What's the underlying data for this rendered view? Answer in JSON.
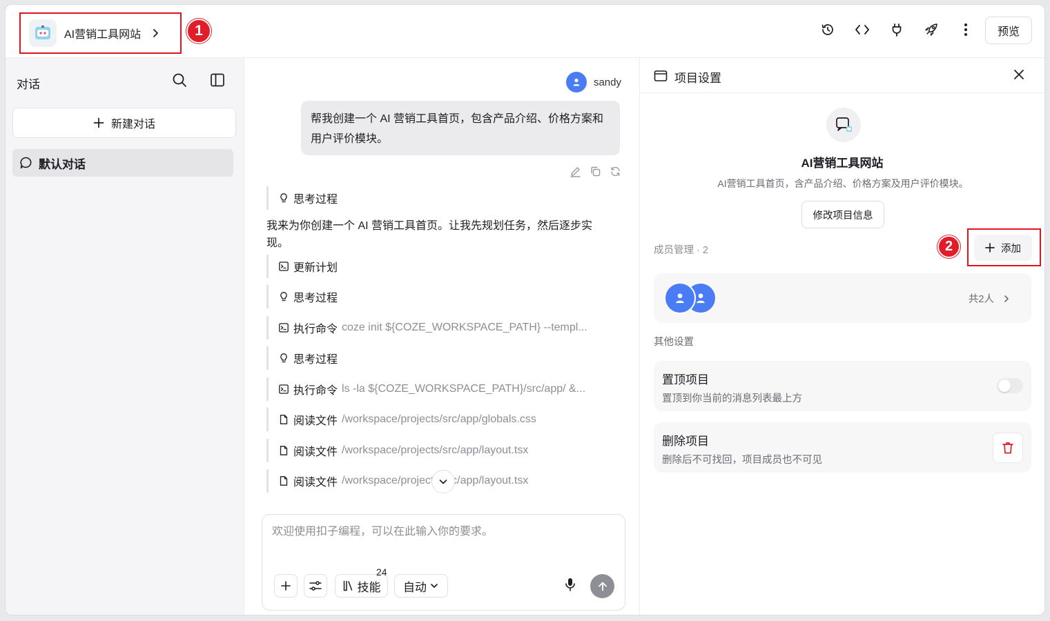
{
  "header": {
    "project_name": "AI营销工具网站",
    "badge1": "1",
    "preview_label": "预览",
    "icons": [
      "history-icon",
      "code-icon",
      "plug-icon",
      "rocket-icon",
      "more-icon"
    ]
  },
  "sidebar": {
    "title": "对话",
    "new_chat_label": "新建对话",
    "items": [
      {
        "label": "默认对话"
      }
    ]
  },
  "chat": {
    "user_name": "sandy",
    "user_message": "帮我创建一个 AI 营销工具首页，包含产品介绍、价格方案和用户评价模块。",
    "thinking1": "思考过程",
    "ai_intro": "我来为你创建一个 AI 营销工具首页。让我先规划任务，然后逐步实现。",
    "steps": [
      {
        "label": "更新计划",
        "arg": ""
      },
      {
        "label": "思考过程",
        "arg": ""
      },
      {
        "label": "执行命令",
        "arg": "coze init ${COZE_WORKSPACE_PATH} --templ..."
      },
      {
        "label": "思考过程",
        "arg": ""
      },
      {
        "label": "执行命令",
        "arg": "ls -la ${COZE_WORKSPACE_PATH}/src/app/ &..."
      },
      {
        "label": "阅读文件",
        "arg": "/workspace/projects/src/app/globals.css"
      },
      {
        "label": "阅读文件",
        "arg": "/workspace/projects/src/app/layout.tsx"
      },
      {
        "label": "阅读文件",
        "arg": "/workspace/projects/src/app/layout.tsx"
      }
    ],
    "composer": {
      "placeholder": "欢迎使用扣子编程，可以在此输入你的要求。",
      "skills_label": "技能",
      "skills_count": "24",
      "mode_label": "自动"
    }
  },
  "settings": {
    "title": "项目设置",
    "project_name": "AI营销工具网站",
    "project_desc": "AI营销工具首页，含产品介绍、价格方案及用户评价模块。",
    "edit_label": "修改项目信息",
    "members_label": "成员管理 · 2",
    "badge2": "2",
    "add_label": "添加",
    "members_total": "共2人",
    "other_label": "其他设置",
    "pin_title": "置顶项目",
    "pin_desc": "置顶到你当前的消息列表最上方",
    "delete_title": "删除项目",
    "delete_desc": "删除后不可找回，项目成员也不可见"
  },
  "colors": {
    "accent": "#4a7cf3",
    "highlight": "#e5121e",
    "danger": "#e01d28"
  }
}
